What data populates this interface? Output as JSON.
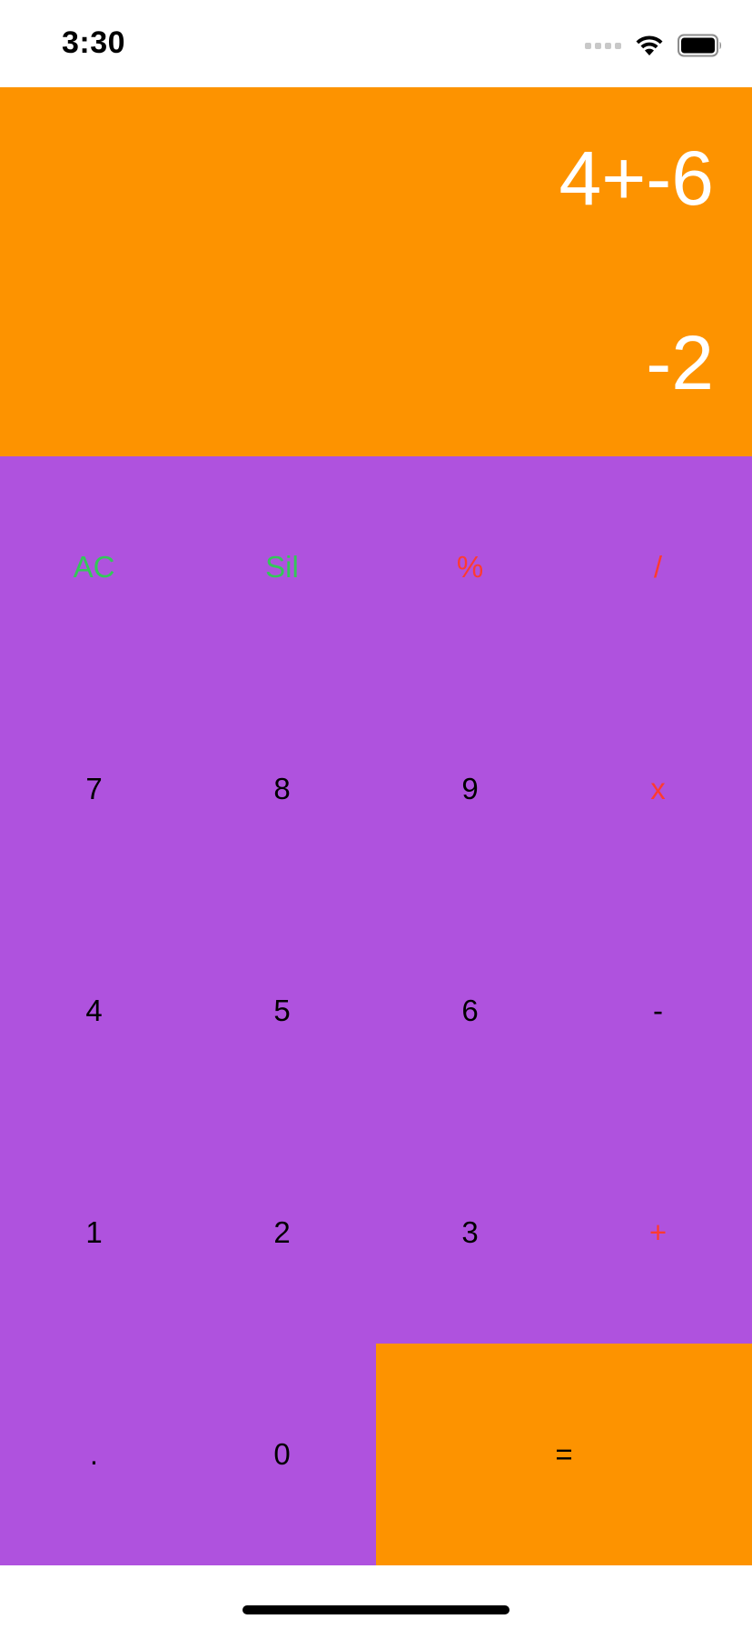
{
  "status_bar": {
    "time": "3:30"
  },
  "display": {
    "expression": "4+-6",
    "result": "-2"
  },
  "keypad": {
    "colors": {
      "keypad_bg": "#af52de",
      "display_bg": "#fd9300",
      "function_key": "#34c759",
      "operator_key": "#ff3b30",
      "number_key": "#000000"
    },
    "keys": {
      "ac": "AC",
      "delete": "Sil",
      "percent": "%",
      "divide": "/",
      "seven": "7",
      "eight": "8",
      "nine": "9",
      "multiply": "x",
      "four": "4",
      "five": "5",
      "six": "6",
      "minus": "-",
      "one": "1",
      "two": "2",
      "three": "3",
      "plus": "+",
      "decimal": ".",
      "zero": "0",
      "equals": "="
    }
  },
  "icons": {
    "signal": "signal-icon",
    "wifi": "wifi-icon",
    "battery": "battery-icon"
  }
}
